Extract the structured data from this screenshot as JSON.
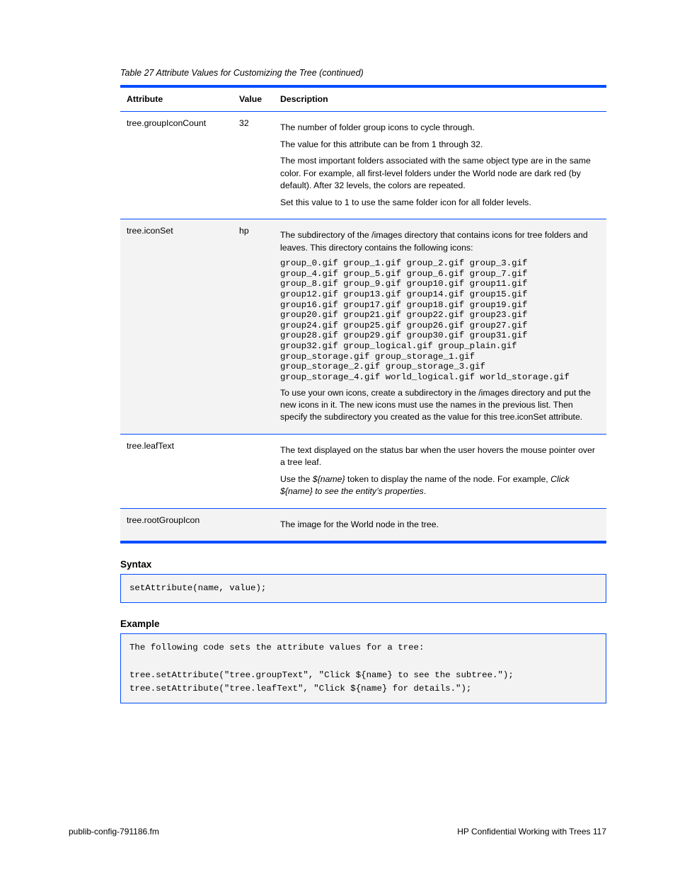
{
  "table": {
    "continued": "Table 27 Attribute Values for Customizing the Tree (continued)",
    "headers": [
      "Attribute",
      "Value",
      "Description"
    ],
    "rows": [
      {
        "attr": "tree.groupIconCount",
        "value": "32",
        "desc_lines": [
          "The number of folder group icons to cycle through.",
          "The value for this attribute can be from 1 through 32.",
          "The most important folders associated with the same object type are in the same color. For example, all first-level folders under the World node are dark red (by default). After 32 levels, the colors are repeated.",
          "Set this value to 1 to use the same folder icon for all folder levels."
        ]
      },
      {
        "attr": "tree.iconSet",
        "value": "hp",
        "desc_before": "The subdirectory of the /images directory that contains icons for tree folders and leaves. This directory contains the following icons:",
        "mono": "group_0.gif group_1.gif group_2.gif group_3.gif\ngroup_4.gif group_5.gif group_6.gif group_7.gif\ngroup_8.gif group_9.gif group10.gif group11.gif\ngroup12.gif group13.gif group14.gif group15.gif\ngroup16.gif group17.gif group18.gif group19.gif\ngroup20.gif group21.gif group22.gif group23.gif\ngroup24.gif group25.gif group26.gif group27.gif\ngroup28.gif group29.gif group30.gif group31.gif\ngroup32.gif group_logical.gif group_plain.gif\ngroup_storage.gif group_storage_1.gif\ngroup_storage_2.gif group_storage_3.gif\ngroup_storage_4.gif world_logical.gif world_storage.gif",
        "desc_after": "To use your own icons, create a subdirectory in the /images directory and put the new icons in it. The new icons must use the names in the previous list. Then specify the subdirectory you created as the value for this tree.iconSet attribute."
      },
      {
        "attr": "tree.leafText",
        "value": "",
        "desc_before": "The text displayed on the status bar when the user hovers the mouse pointer over a tree leaf.",
        "desc_after_html": "Use the <span class=\"em\">${name}</span> token to display the name of the node. For example, <span class=\"em\">Click ${name} to see the entity’s properties</span>."
      },
      {
        "attr": "tree.rootGroupIcon",
        "value": "",
        "desc_lines": [
          "The image for the World node in the tree."
        ]
      }
    ]
  },
  "syntax": {
    "label": "Syntax",
    "box1": "setAttribute(name, value);",
    "label2": "Example",
    "box2": "The following code sets the attribute values for a tree:\n\ntree.setAttribute(\"tree.groupText\", \"Click ${name} to see the subtree.\");\ntree.setAttribute(\"tree.leafText\", \"Click ${name} for details.\");"
  },
  "footer": {
    "left": "publib-config-791186.fm",
    "right": "HP Confidential     Working with Trees     117"
  }
}
